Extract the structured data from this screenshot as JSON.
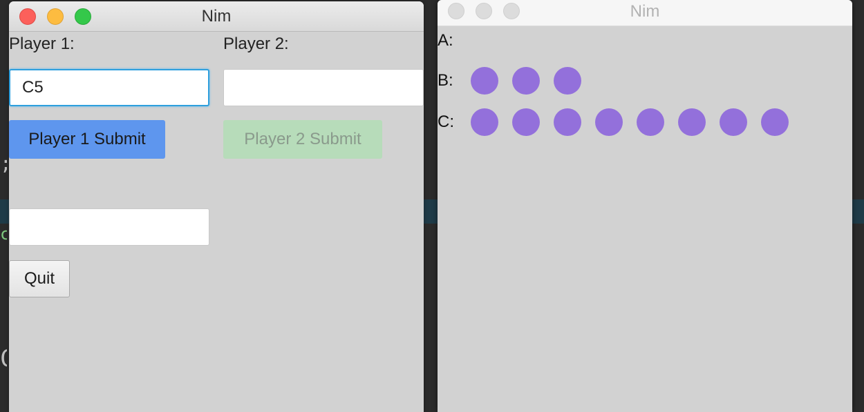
{
  "background": {
    "fragments": [
      ";",
      "c",
      "C"
    ]
  },
  "left_window": {
    "title": "Nim",
    "player1_label": "Player 1:",
    "player2_label": "Player 2:",
    "player1_input_value": "C5",
    "player2_input_value": "",
    "message_field_value": "",
    "player1_submit_label": "Player 1 Submit",
    "player2_submit_label": "Player 2 Submit",
    "player2_submit_disabled": true,
    "quit_label": "Quit"
  },
  "right_window": {
    "title": "Nim",
    "rows": [
      {
        "label": "A:",
        "count": 0
      },
      {
        "label": "B:",
        "count": 3
      },
      {
        "label": "C:",
        "count": 8
      }
    ],
    "dot_color": "#9370db"
  },
  "colors": {
    "primary_button": "#5e96ee",
    "disabled_button": "#b7dcba",
    "focus_ring": "#2e9fdd"
  }
}
